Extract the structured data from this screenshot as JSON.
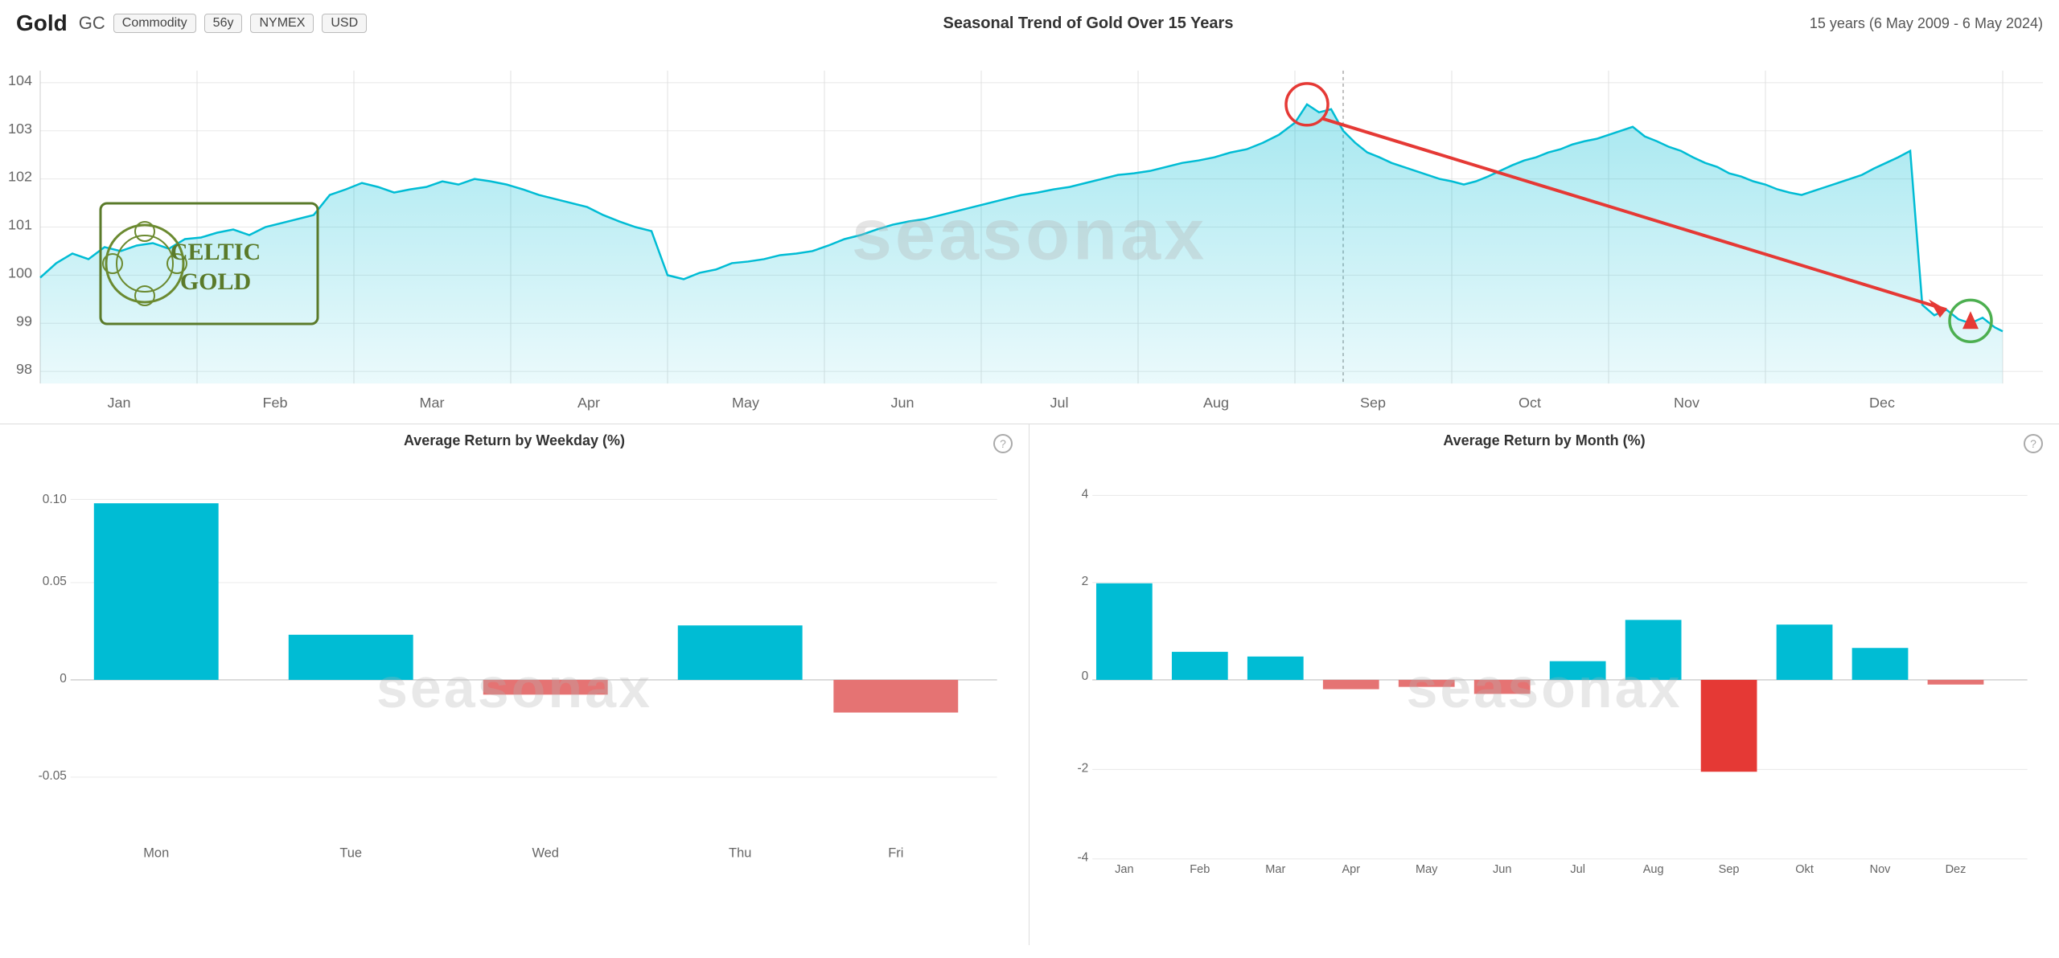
{
  "header": {
    "title": "Gold",
    "ticker": "GC",
    "badges": [
      "Commodity",
      "56y",
      "NYMEX",
      "USD"
    ],
    "center_title": "Seasonal Trend of Gold Over 15 Years",
    "right_text": "15 years (6 May 2009 - 6 May 2024)"
  },
  "main_chart": {
    "y_axis": [
      104,
      103,
      102,
      101,
      100,
      99,
      98
    ],
    "x_axis": [
      "Jan",
      "Feb",
      "Mar",
      "Apr",
      "May",
      "Jun",
      "Jul",
      "Aug",
      "Sep",
      "Oct",
      "Nov",
      "Dec"
    ],
    "watermark": "seasonax"
  },
  "bottom_left": {
    "title": "Average Return by Weekday (%)",
    "watermark": "seasonax",
    "x_axis": [
      "Mon",
      "Tue",
      "Wed",
      "Thu",
      "Fri"
    ],
    "y_axis": [
      0.1,
      0.05,
      0,
      -0.05
    ],
    "bars": [
      {
        "label": "Mon",
        "value": 0.098,
        "positive": true
      },
      {
        "label": "Tue",
        "value": 0.025,
        "positive": true
      },
      {
        "label": "Wed",
        "value": -0.008,
        "positive": false
      },
      {
        "label": "Thu",
        "value": 0.03,
        "positive": true
      },
      {
        "label": "Fri",
        "value": -0.018,
        "positive": false
      }
    ]
  },
  "bottom_right": {
    "title": "Average Return by Month (%)",
    "watermark": "seasonax",
    "x_axis": [
      "Jan",
      "Feb",
      "Mar",
      "Apr",
      "May",
      "Jun",
      "Jul",
      "Aug",
      "Sep",
      "Okt",
      "Nov",
      "Dez"
    ],
    "y_axis": [
      4,
      2,
      0,
      -2,
      -4
    ],
    "bars": [
      {
        "label": "Jan",
        "value": 2.1,
        "positive": true
      },
      {
        "label": "Feb",
        "value": 0.6,
        "positive": true
      },
      {
        "label": "Mar",
        "value": 0.5,
        "positive": true
      },
      {
        "label": "Apr",
        "value": -0.2,
        "positive": false
      },
      {
        "label": "May",
        "value": -0.15,
        "positive": false
      },
      {
        "label": "Jun",
        "value": -0.3,
        "positive": false
      },
      {
        "label": "Jul",
        "value": 0.4,
        "positive": true
      },
      {
        "label": "Aug",
        "value": 1.3,
        "positive": true
      },
      {
        "label": "Sep",
        "value": -2.0,
        "positive": false
      },
      {
        "label": "Okt",
        "value": 1.2,
        "positive": true
      },
      {
        "label": "Nov",
        "value": 0.7,
        "positive": true
      },
      {
        "label": "Dez",
        "value": -0.1,
        "positive": false
      }
    ]
  }
}
